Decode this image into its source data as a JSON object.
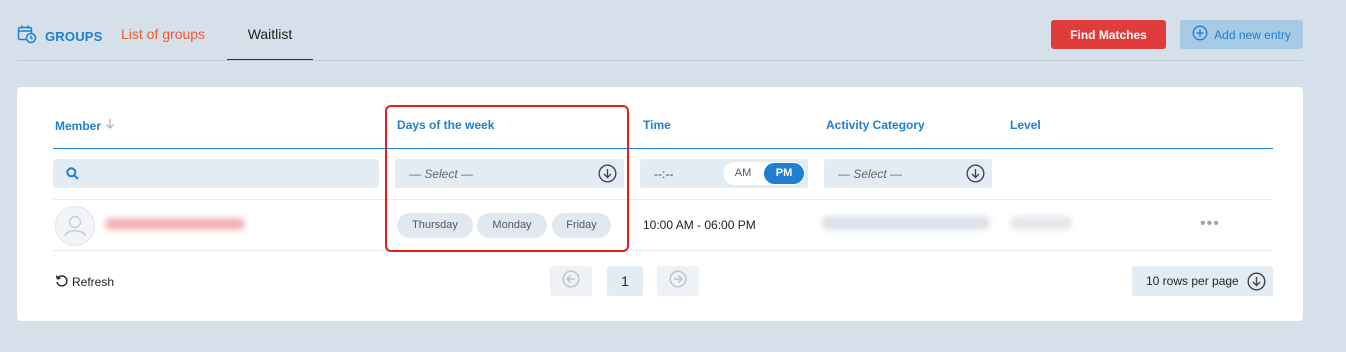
{
  "header": {
    "brand": "GROUPS",
    "tabs": [
      {
        "label": "List of groups",
        "active": false
      },
      {
        "label": "Waitlist",
        "active": true
      }
    ],
    "find_matches_label": "Find Matches",
    "add_entry_label": "Add new entry"
  },
  "table": {
    "columns": [
      "Member",
      "Days of the week",
      "Time",
      "Activity Category",
      "Level"
    ],
    "filters": {
      "days_placeholder": "— Select —",
      "time_placeholder": "--:--",
      "am_label": "AM",
      "pm_label": "PM",
      "pm_selected": true,
      "category_placeholder": "— Select —"
    },
    "rows": [
      {
        "days": [
          "Thursday",
          "Monday",
          "Friday"
        ],
        "time": "10:00 AM - 06:00 PM"
      }
    ]
  },
  "footer": {
    "refresh_label": "Refresh",
    "page": "1",
    "rows_per_page": "10 rows per page"
  },
  "colors": {
    "accent": "#1f7fd0",
    "danger": "#e03c3c",
    "tab_link": "#f0592d",
    "background": "#d5e0ea"
  }
}
